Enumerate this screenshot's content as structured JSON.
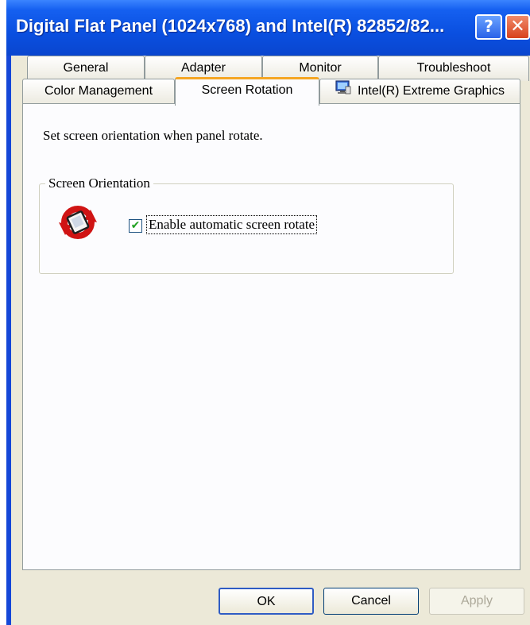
{
  "window": {
    "title": "Digital Flat Panel (1024x768) and Intel(R) 82852/82...",
    "help_label": "?",
    "close_label": "✕"
  },
  "tabs": {
    "row_back": [
      "General",
      "Adapter",
      "Monitor",
      "Troubleshoot"
    ],
    "row_front": [
      "Color Management",
      "Screen Rotation",
      "Intel(R) Extreme Graphics"
    ],
    "active": "Screen Rotation",
    "intel_tab_icon": "monitor-graphics-icon"
  },
  "content": {
    "instruction": "Set screen orientation when panel rotate.",
    "group_label": "Screen Orientation",
    "rotate_icon": "screen-rotation-icon",
    "checkbox_label": "Enable automatic screen rotate",
    "checkbox_checked": true,
    "check_mark": "✔"
  },
  "buttons": {
    "ok": "OK",
    "cancel": "Cancel",
    "apply": "Apply"
  },
  "colors": {
    "titlebar": "#0a4fe0",
    "active_tab_accent": "#f5a623",
    "dialog_bg": "#ece9d8",
    "panel_bg": "#fcfcfe"
  }
}
